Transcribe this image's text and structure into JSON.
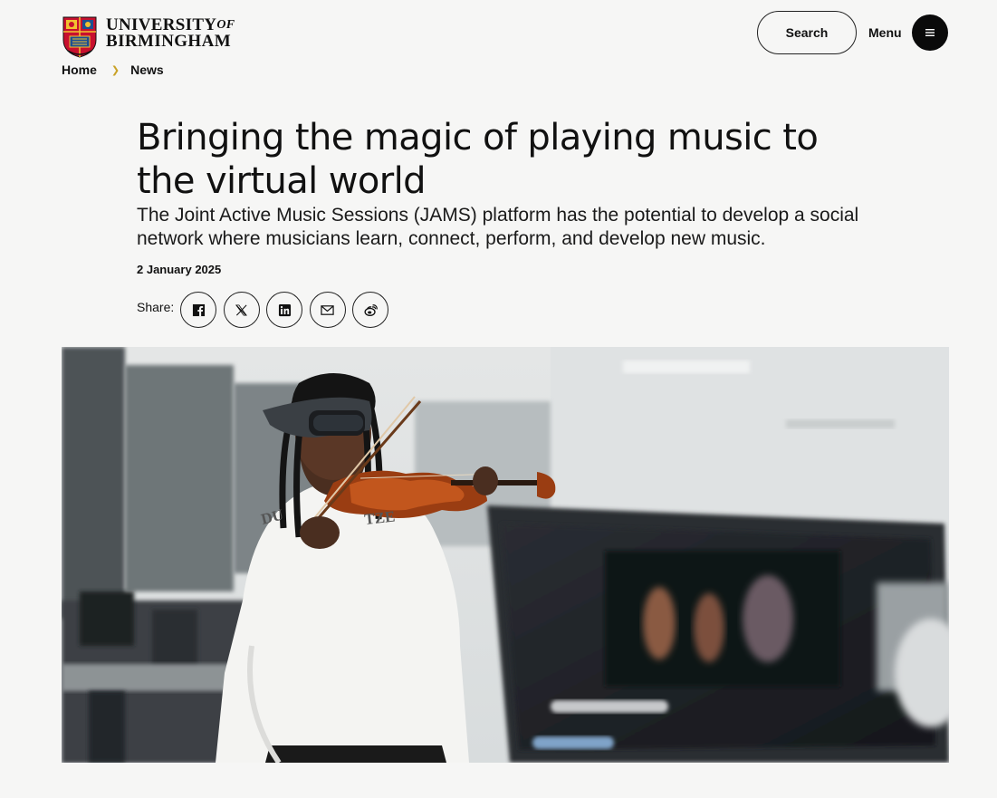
{
  "header": {
    "logo": {
      "line1": "UNIVERSITY",
      "of": "OF",
      "line2": "BIRMINGHAM",
      "crest_icon": "university-crest"
    },
    "search_label": "Search",
    "menu_label": "Menu",
    "menu_icon": "hamburger-icon"
  },
  "breadcrumb": {
    "items": [
      "Home",
      "News"
    ],
    "separator_icon": "chevron-right-icon"
  },
  "article": {
    "title": "Bringing the magic of playing music to the virtual world",
    "subtitle": "The Joint Active Music Sessions (JAMS) platform has the potential to develop a social network where musicians learn, connect, perform, and develop new music.",
    "date": "2 January 2025",
    "share_label": "Share:",
    "share_icons": [
      "facebook-icon",
      "x-icon",
      "linkedin-icon",
      "email-icon",
      "weibo-icon"
    ]
  },
  "hero_image": {
    "subject": "student-with-vr-headset-playing-violin",
    "sweater_text": "DU... ZE"
  },
  "colors": {
    "background": "#f6f6f5",
    "text": "#111111",
    "accent": "#c9a227",
    "menu_button": "#0a0a0a"
  }
}
